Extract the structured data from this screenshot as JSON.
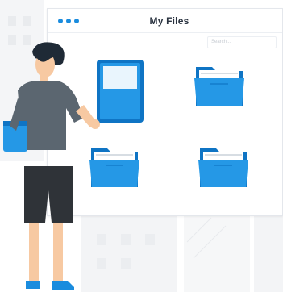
{
  "window": {
    "title": "My Files",
    "search_placeholder": "Search..."
  },
  "folders": [
    {
      "name": "folder-top-left",
      "state": "open"
    },
    {
      "name": "folder-top-right",
      "state": "closed"
    },
    {
      "name": "folder-bottom-left",
      "state": "closed"
    },
    {
      "name": "folder-bottom-right",
      "state": "closed"
    }
  ],
  "colors": {
    "accent": "#1a8cde",
    "folder_dark": "#0f74c4",
    "folder_light": "#2598e6",
    "shirt": "#5b6670",
    "shorts": "#2f3338",
    "hair": "#1f2a36",
    "skin": "#f7c9a2"
  }
}
